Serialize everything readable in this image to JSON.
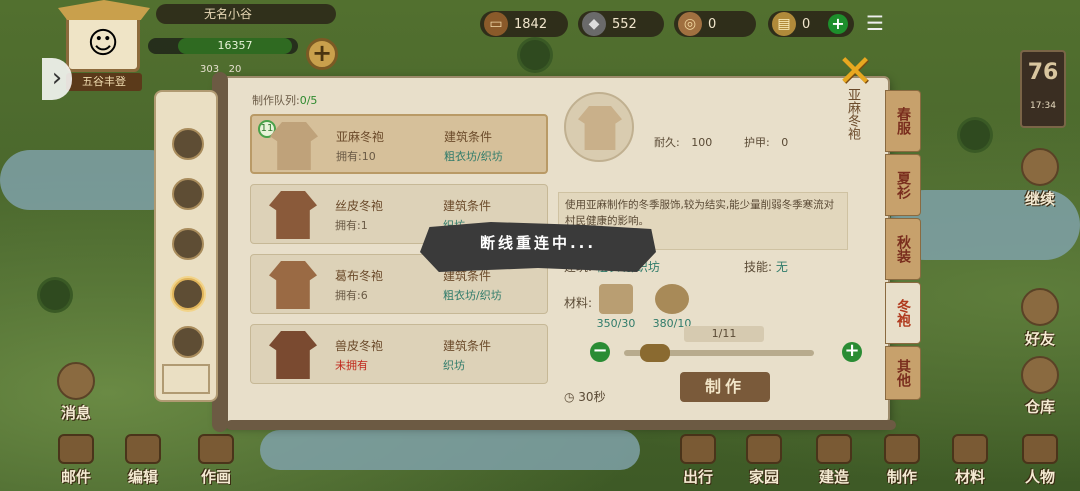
{
  "topbar": {
    "village_name": "无名小谷",
    "exp_value": "16357",
    "stats_left": "303",
    "stats_right": "20",
    "title_tag": "五谷丰登",
    "resources": [
      {
        "icon": "wood-log-icon",
        "value": "1842"
      },
      {
        "icon": "stone-ore-icon",
        "value": "552"
      },
      {
        "icon": "coin-icon",
        "value": "0"
      },
      {
        "icon": "ticket-icon",
        "value": "0"
      }
    ]
  },
  "day": {
    "number": "76",
    "time": "17:34"
  },
  "crafting": {
    "queue_label": "制作队列:",
    "queue_value": "0/5",
    "items": [
      {
        "name": "亚麻冬袍",
        "owned": "拥有:10",
        "cond_label": "建筑条件",
        "building": "粗衣坊/织坊",
        "badge": "11",
        "selected": true,
        "owned_red": false
      },
      {
        "name": "丝皮冬袍",
        "owned": "拥有:1",
        "cond_label": "建筑条件",
        "building": "织坊",
        "selected": false,
        "owned_red": false
      },
      {
        "name": "葛布冬袍",
        "owned": "拥有:6",
        "cond_label": "建筑条件",
        "building": "粗衣坊/织坊",
        "selected": false,
        "owned_red": false
      },
      {
        "name": "兽皮冬袍",
        "owned": "未拥有",
        "cond_label": "建筑条件",
        "building": "织坊",
        "selected": false,
        "owned_red": true
      }
    ],
    "detail": {
      "vertical_title": "亚麻冬袍",
      "durability_label": "耐久:",
      "durability": "100",
      "armor_label": "护甲:",
      "armor": "0",
      "description": "使用亚麻制作的冬季服饰,较为结实,能少量削弱冬季寒流对村民健康的影响。",
      "building_label": "建筑:",
      "building": "粗衣坊/织坊",
      "skill_label": "技能:",
      "skill": "无",
      "materials_label": "材料:",
      "materials": [
        {
          "icon": "linen-cloth-icon",
          "qty": "350/30"
        },
        {
          "icon": "fiber-bundle-icon",
          "qty": "380/10"
        }
      ],
      "quantity": "1/11",
      "time": "30秒",
      "make_label": "制作"
    },
    "tabs": [
      "春服",
      "夏衫",
      "秋装",
      "冬袍",
      "其他"
    ],
    "active_tab": 3,
    "reconnect_text": "断线重连中..."
  },
  "side_buttons": {
    "continue": "继续",
    "friends": "好友",
    "warehouse": "仓库"
  },
  "left_buttons": {
    "messages": "消息",
    "mail": "邮件",
    "edit": "编辑",
    "paint": "作画"
  },
  "bottom_buttons": [
    "出行",
    "家园",
    "建造",
    "制作",
    "材料",
    "人物"
  ],
  "colors": {
    "panel_bg": "#e8dfca",
    "building_text": "#2f7b6a",
    "not_owned": "#c0281c",
    "tab_text": "#7a2e1e",
    "accent_green": "#2a8c34"
  }
}
